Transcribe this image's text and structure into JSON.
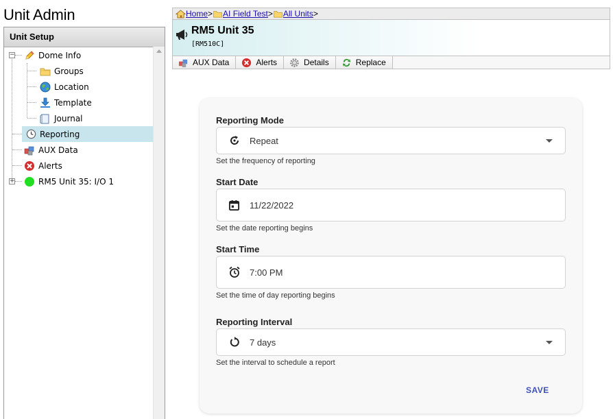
{
  "app": {
    "title": "Unit Admin"
  },
  "left_panel": {
    "title": "Unit Setup",
    "tree": [
      {
        "label": "Dome Info",
        "icon": "pencil-icon",
        "expanded": true
      },
      {
        "label": "Groups",
        "icon": "folder-icon"
      },
      {
        "label": "Location",
        "icon": "globe-icon"
      },
      {
        "label": "Template",
        "icon": "download-icon"
      },
      {
        "label": "Journal",
        "icon": "page-icon"
      },
      {
        "label": "Reporting",
        "icon": "clock-icon",
        "selected": true
      },
      {
        "label": "AUX Data",
        "icon": "blocks-icon"
      },
      {
        "label": "Alerts",
        "icon": "alert-icon"
      },
      {
        "label": "RM5 Unit 35: I/O 1",
        "icon": "green-dot-icon",
        "expanded": false
      }
    ]
  },
  "breadcrumb": {
    "items": [
      "Home",
      "AI Field Test",
      "All Units"
    ],
    "separator": ">"
  },
  "unit": {
    "name": "RM5 Unit 35",
    "model": "[RM510C]"
  },
  "tabs": [
    {
      "label": "AUX Data",
      "icon": "blocks-icon"
    },
    {
      "label": "Alerts",
      "icon": "alert-icon"
    },
    {
      "label": "Details",
      "icon": "gear-icon"
    },
    {
      "label": "Replace",
      "icon": "refresh-icon"
    }
  ],
  "form": {
    "reporting_mode": {
      "label": "Reporting Mode",
      "value": "Repeat",
      "help": "Set the frequency of reporting",
      "icon": "repeat-icon"
    },
    "start_date": {
      "label": "Start Date",
      "value": "11/22/2022",
      "help": "Set the date reporting begins",
      "icon": "calendar-icon"
    },
    "start_time": {
      "label": "Start Time",
      "value": "7:00 PM",
      "help": "Set the time of day reporting begins",
      "icon": "alarm-icon"
    },
    "interval": {
      "label": "Reporting Interval",
      "value": "7 days",
      "help": "Set the interval to schedule a report",
      "icon": "interval-icon"
    },
    "save_label": "SAVE"
  },
  "colors": {
    "selected_row": "#c8e4ed",
    "save": "#3f51b5",
    "link": "#1a0dab"
  }
}
